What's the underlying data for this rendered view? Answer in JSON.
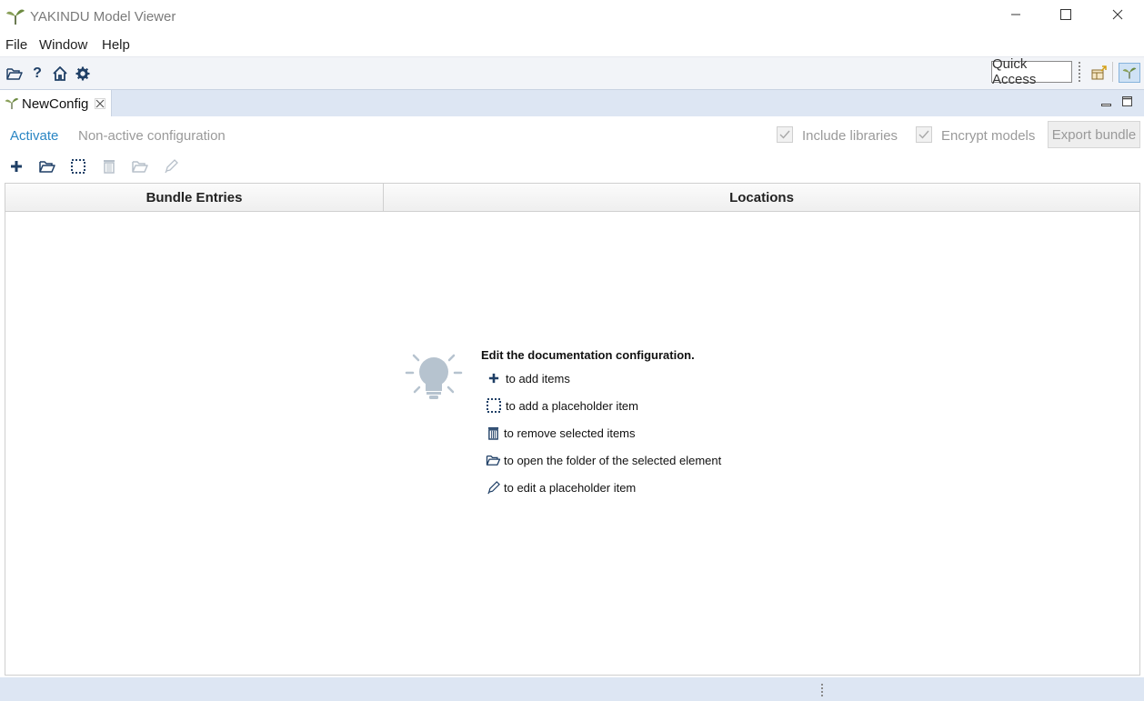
{
  "window": {
    "title": "YAKINDU Model Viewer",
    "controls": [
      "minimize-icon",
      "maximize-icon",
      "close-icon"
    ]
  },
  "menu": {
    "items": [
      "File",
      "Window",
      "Help"
    ]
  },
  "toolbar": {
    "icons": [
      "open-folder-icon",
      "help-icon",
      "home-icon",
      "settings-gear-icon"
    ],
    "quick_access": "Quick Access",
    "perspective_icons": [
      "open-perspective-icon",
      "yakindu-perspective-icon"
    ]
  },
  "editor_tab": {
    "label": "NewConfig",
    "icon": "yakindu-sprout-icon"
  },
  "config_bar": {
    "activate": "Activate",
    "status": "Non-active configuration",
    "include_libraries": {
      "label": "Include libraries",
      "checked": true
    },
    "encrypt_models": {
      "label": "Encrypt models",
      "checked": true
    },
    "export_bundle": "Export bundle"
  },
  "actions": {
    "icons": [
      "add-icon",
      "open-folder-icon",
      "placeholder-icon",
      "trash-icon",
      "folder-icon",
      "pencil-icon"
    ]
  },
  "table": {
    "columns": [
      "Bundle Entries",
      "Locations"
    ]
  },
  "hint": {
    "title": "Edit the documentation configuration.",
    "items": [
      {
        "icon": "add-icon",
        "text": "to add items"
      },
      {
        "icon": "placeholder-icon",
        "text": "to add a placeholder item"
      },
      {
        "icon": "trash-icon",
        "text": "to remove selected items"
      },
      {
        "icon": "folder-icon",
        "text": "to open the folder of the selected element"
      },
      {
        "icon": "pencil-icon",
        "text": "to edit a placeholder item"
      }
    ]
  },
  "colors": {
    "accent_link": "#2a86c4",
    "icon_navy": "#1f3f66",
    "tabstrip": "#dde6f3",
    "toolbar": "#f2f4f8"
  }
}
